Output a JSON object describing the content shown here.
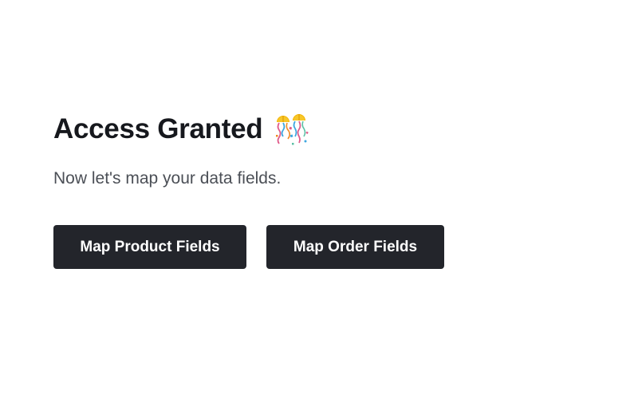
{
  "heading": {
    "title": "Access Granted",
    "icon": "confetti-icon"
  },
  "subtitle": "Now let's map your data fields.",
  "buttons": {
    "product_label": "Map Product Fields",
    "order_label": "Map Order Fields"
  },
  "colors": {
    "button_background": "#23252b",
    "button_text": "#ffffff",
    "title_text": "#16181d",
    "subtitle_text": "#4b4f56",
    "page_background": "#ffffff"
  }
}
